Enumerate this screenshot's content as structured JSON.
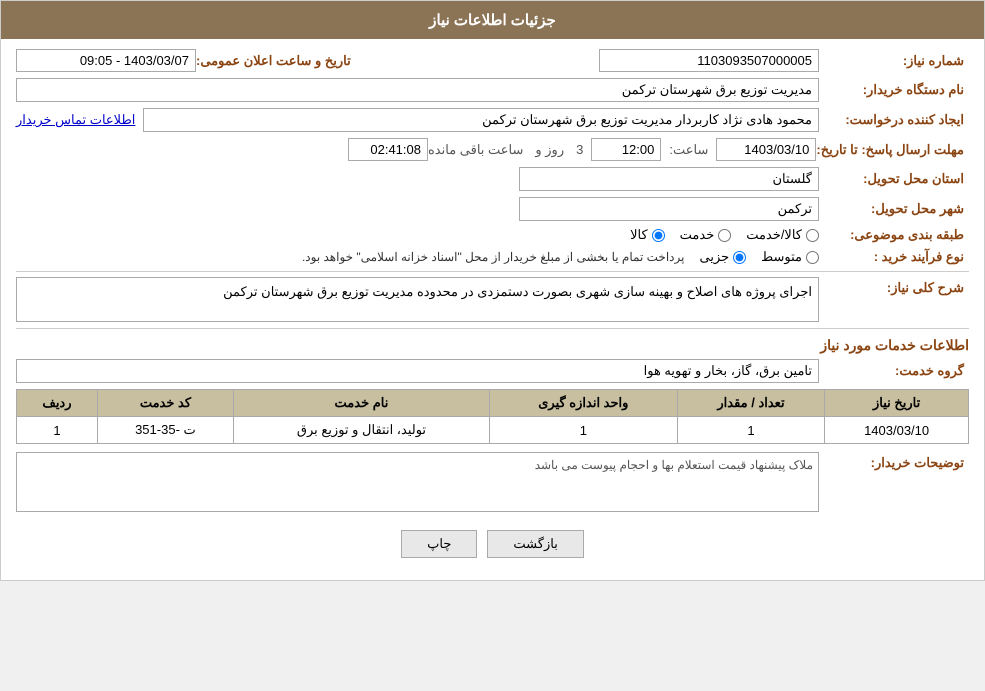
{
  "header": {
    "title": "جزئیات اطلاعات نیاز"
  },
  "form": {
    "need_number_label": "شماره نیاز:",
    "need_number_value": "1103093507000005",
    "announce_date_label": "تاریخ و ساعت اعلان عمومی:",
    "announce_date_value": "1403/03/07 - 09:05",
    "org_name_label": "نام دستگاه خریدار:",
    "org_name_value": "مدیریت توزیع برق شهرستان ترکمن",
    "creator_label": "ایجاد کننده درخواست:",
    "creator_value": "محمود  هادی نژاد کاربردار مدیریت توزیع برق شهرستان ترکمن",
    "contact_link": "اطلاعات تماس خریدار",
    "reply_deadline_label": "مهلت ارسال پاسخ: تا تاریخ:",
    "reply_date_value": "1403/03/10",
    "reply_time_label": "ساعت:",
    "reply_time_value": "12:00",
    "reply_days_label": "روز و",
    "reply_days_value": "3",
    "remaining_label": "ساعت باقی مانده",
    "remaining_time_value": "02:41:08",
    "province_label": "استان محل تحویل:",
    "province_value": "گلستان",
    "city_label": "شهر محل تحویل:",
    "city_value": "ترکمن",
    "category_label": "طبقه بندی موضوعی:",
    "category_options": [
      {
        "label": "کالا",
        "checked": true
      },
      {
        "label": "خدمت",
        "checked": false
      },
      {
        "label": "کالا/خدمت",
        "checked": false
      }
    ],
    "purchase_type_label": "نوع فرآیند خرید :",
    "purchase_type_options": [
      {
        "label": "جزیی",
        "checked": true
      },
      {
        "label": "متوسط",
        "checked": false
      }
    ],
    "purchase_type_note": "پرداخت تمام یا بخشی از مبلغ خریدار از محل \"اسناد خزانه اسلامی\" خواهد بود.",
    "description_label": "شرح کلی نیاز:",
    "description_value": "اجرای پروژه های اصلاح و بهینه سازی شهری بصورت دستمزدی در محدوده مدیریت توزیع برق شهرستان ترکمن",
    "services_info_title": "اطلاعات خدمات مورد نیاز",
    "service_group_label": "گروه خدمت:",
    "service_group_value": "تامین برق، گاز، بخار و تهویه هوا",
    "table_headers": {
      "row_num": "ردیف",
      "service_code": "کد خدمت",
      "service_name": "نام خدمت",
      "unit": "واحد اندازه گیری",
      "quantity": "تعداد / مقدار",
      "need_date": "تاریخ نیاز"
    },
    "table_rows": [
      {
        "row_num": "1",
        "service_code": "ت -35-351",
        "service_name": "تولید، انتقال و توزیع برق",
        "unit": "1",
        "quantity": "1",
        "need_date": "1403/03/10"
      }
    ],
    "buyer_notes_label": "توضیحات خریدار:",
    "buyer_notes_value": "ملاک پیشنهاد قیمت استعلام بها و احجام پیوست می باشد",
    "btn_print": "چاپ",
    "btn_back": "بازگشت"
  }
}
